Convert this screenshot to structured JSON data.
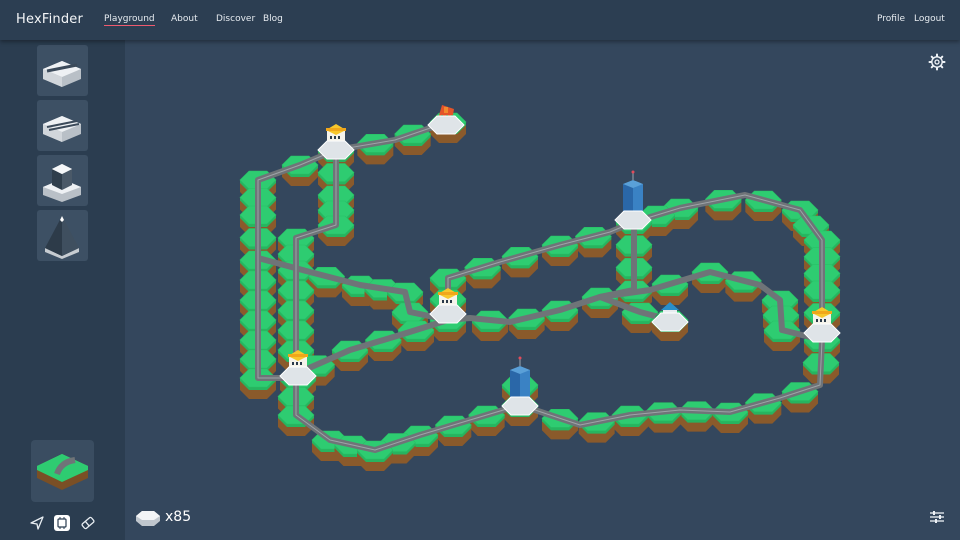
{
  "app": {
    "brand": "HexFinder"
  },
  "nav": {
    "playground": "Playground",
    "about": "About",
    "discover": "Discover",
    "blog": "Blog",
    "profile": "Profile",
    "logout": "Logout"
  },
  "inventory": {
    "count": "x85"
  },
  "palette": {
    "grass": "#2ecc71",
    "soil": "#8a5a2b",
    "road": "#6f7478",
    "bg": "#34475d",
    "sidebar": "#2b3d50",
    "topbar": "#2c3e52",
    "accent": "#ef5a6f"
  },
  "sidebar_tiles": [
    {
      "icon": "ramp-tile-icon"
    },
    {
      "icon": "double-ramp-tile-icon"
    },
    {
      "icon": "building-tile-icon"
    },
    {
      "icon": "mountain-tile-icon"
    }
  ],
  "tools": [
    {
      "icon": "pointer-icon"
    },
    {
      "icon": "chip-icon"
    },
    {
      "icon": "eraser-icon"
    }
  ]
}
